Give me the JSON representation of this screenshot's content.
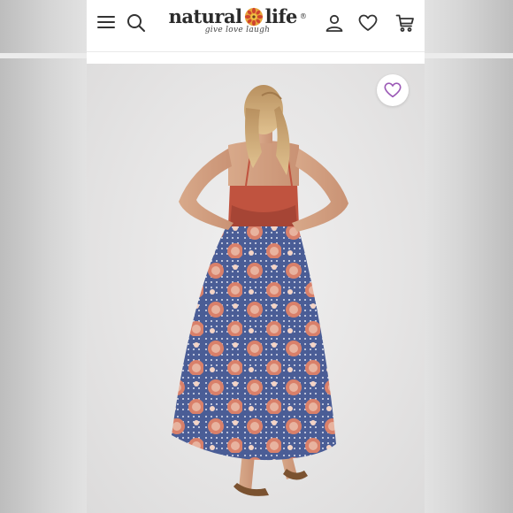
{
  "site": {
    "brand_left": "natural",
    "brand_right": "life",
    "trademark": "®",
    "tagline": "give love laugh"
  },
  "colors": {
    "accent_wishlist": "#9b59b6",
    "icon": "#333333",
    "dress_blue": "#4a5d96",
    "dress_red": "#c0533f",
    "hair": "#c9a06a"
  },
  "icons": {
    "menu": "hamburger-icon",
    "search": "search-icon",
    "logo": "flower-logo-icon",
    "account": "user-icon",
    "wishlist": "heart-icon",
    "cart": "cart-icon",
    "product_wishlist": "heart-outline-icon"
  },
  "product_image": {
    "description_visible": false
  }
}
